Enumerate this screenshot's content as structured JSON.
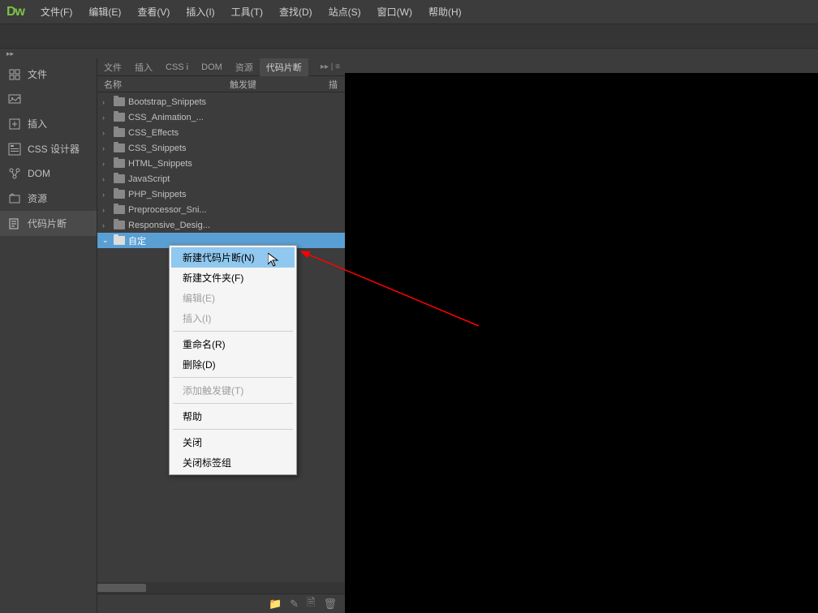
{
  "app": {
    "logo": "Dw"
  },
  "menubar": [
    "文件(F)",
    "编辑(E)",
    "查看(V)",
    "插入(I)",
    "工具(T)",
    "查找(D)",
    "站点(S)",
    "窗口(W)",
    "帮助(H)"
  ],
  "sidebar": [
    {
      "label": "文件",
      "icon": "files"
    },
    {
      "label": "",
      "icon": "image"
    },
    {
      "label": "插入",
      "icon": "insert"
    },
    {
      "label": "CSS 设计器",
      "icon": "css"
    },
    {
      "label": "DOM",
      "icon": "dom"
    },
    {
      "label": "资源",
      "icon": "assets"
    },
    {
      "label": "代码片断",
      "icon": "snippets",
      "active": true
    }
  ],
  "panel": {
    "tabs": [
      "文件",
      "插入",
      "CSS i",
      "DOM",
      "资源"
    ],
    "active_tab": "代码片断",
    "header": {
      "name": "名称",
      "trigger": "触发键",
      "desc": "描"
    },
    "tree": [
      {
        "label": "Bootstrap_Snippets"
      },
      {
        "label": "CSS_Animation_..."
      },
      {
        "label": "CSS_Effects"
      },
      {
        "label": "CSS_Snippets"
      },
      {
        "label": "HTML_Snippets"
      },
      {
        "label": "JavaScript"
      },
      {
        "label": "PHP_Snippets"
      },
      {
        "label": "Preprocessor_Sni..."
      },
      {
        "label": "Responsive_Desig..."
      },
      {
        "label": "自定",
        "selected": true,
        "expanded": true
      }
    ]
  },
  "context_menu": {
    "items": [
      {
        "label": "新建代码片断(N)",
        "highlighted": true
      },
      {
        "label": "新建文件夹(F)"
      },
      {
        "label": "编辑(E)",
        "disabled": true
      },
      {
        "label": "插入(I)",
        "disabled": true
      },
      {
        "type": "sep"
      },
      {
        "label": "重命名(R)"
      },
      {
        "label": "删除(D)"
      },
      {
        "type": "sep"
      },
      {
        "label": "添加触发键(T)",
        "disabled": true
      },
      {
        "type": "sep"
      },
      {
        "label": "帮助"
      },
      {
        "type": "sep"
      },
      {
        "label": "关闭"
      },
      {
        "label": "关闭标签组"
      }
    ]
  }
}
